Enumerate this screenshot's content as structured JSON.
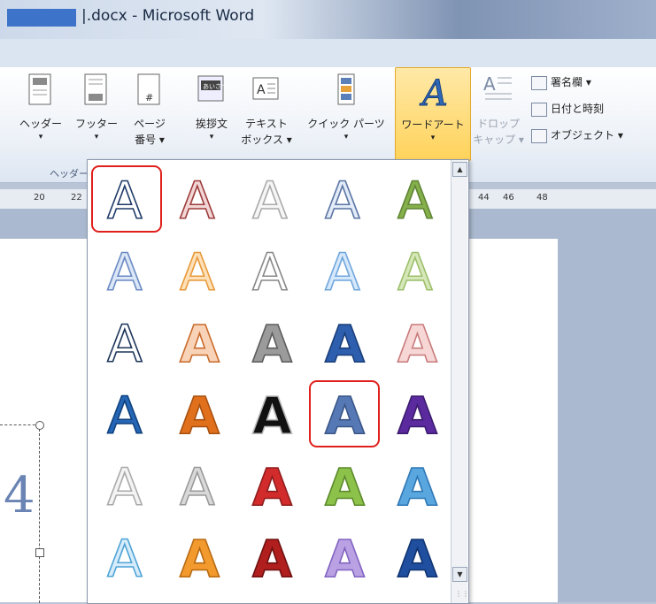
{
  "window": {
    "title_file": ".docx",
    "title_app": "Microsoft Word",
    "title_sep": " - "
  },
  "ribbon": {
    "header": {
      "label": "ヘッダー"
    },
    "footer": {
      "label": "フッター"
    },
    "page_number": {
      "label1": "ページ",
      "label2": "番号"
    },
    "group_header_footer": "ヘッダー",
    "greeting": {
      "label": "挨拶文"
    },
    "textbox": {
      "label1": "テキスト",
      "label2": "ボックス"
    },
    "quick_parts": {
      "label": "クイック パーツ"
    },
    "wordart": {
      "label": "ワードアート"
    },
    "dropcap": {
      "label1": "ドロップ",
      "label2": "キャップ"
    },
    "signature": {
      "label": "署名欄"
    },
    "datetime": {
      "label": "日付と時刻"
    },
    "object": {
      "label": "オブジェクト"
    },
    "greeting_icon_text": "あいさつ"
  },
  "ruler": {
    "ticks": [
      "20",
      "22",
      "44",
      "46",
      "48"
    ]
  },
  "document": {
    "visible_char": "4"
  },
  "gallery": {
    "selected_styles": [
      0,
      18
    ],
    "styles": [
      {
        "fill": "#ffffff",
        "stroke": "#1f3a68"
      },
      {
        "fill": "#f2d6d6",
        "stroke": "#9d3b3b"
      },
      {
        "fill": "#f6f6f6",
        "stroke": "#aaaaaa"
      },
      {
        "fill": "#e2ebf7",
        "stroke": "#5a74a3"
      },
      {
        "fill": "#86b04b",
        "stroke": "#5f8534"
      },
      {
        "fill": "#dbe6f6",
        "stroke": "#6b8ac4"
      },
      {
        "fill": "#ffe0b8",
        "stroke": "#e79a3b"
      },
      {
        "fill": "#ffffff",
        "stroke": "#888888"
      },
      {
        "fill": "#d6e8fb",
        "stroke": "#6fa6dc"
      },
      {
        "fill": "#d6e7b9",
        "stroke": "#9cbf6b"
      },
      {
        "fill": "#ffffff",
        "stroke": "#1a3358"
      },
      {
        "fill": "#f9d3b7",
        "stroke": "#c96b2c"
      },
      {
        "fill": "#9b9b9b",
        "stroke": "#5c5c5c"
      },
      {
        "fill": "#2e5fae",
        "stroke": "#1a3e7a"
      },
      {
        "fill": "#f7d6d6",
        "stroke": "#c97b7b"
      },
      {
        "fill": "#2566b6",
        "stroke": "#10427e"
      },
      {
        "fill": "#e0701c",
        "stroke": "#a8500f"
      },
      {
        "fill": "#111111",
        "stroke": "#bbbbbb"
      },
      {
        "fill": "#5679b6",
        "stroke": "#3a5587"
      },
      {
        "fill": "#5a2a9e",
        "stroke": "#3b1b6e"
      },
      {
        "fill": "#f4f4f4",
        "stroke": "#aaaaaa"
      },
      {
        "fill": "#d9d9d9",
        "stroke": "#9a9a9a"
      },
      {
        "fill": "#d22b2b",
        "stroke": "#8f1c1c"
      },
      {
        "fill": "#8cc14a",
        "stroke": "#5c8a2b"
      },
      {
        "fill": "#5aa6df",
        "stroke": "#2d77b5"
      },
      {
        "fill": "#d6ecfa",
        "stroke": "#4fa3d6"
      },
      {
        "fill": "#f29a2e",
        "stroke": "#b86a12"
      },
      {
        "fill": "#b01e1e",
        "stroke": "#6f1010"
      },
      {
        "fill": "#b9a1e3",
        "stroke": "#8163c1"
      },
      {
        "fill": "#1f4f9e",
        "stroke": "#113472"
      }
    ]
  },
  "colors": {
    "highlight": "#ffd35b",
    "selection": "#e0201c"
  }
}
